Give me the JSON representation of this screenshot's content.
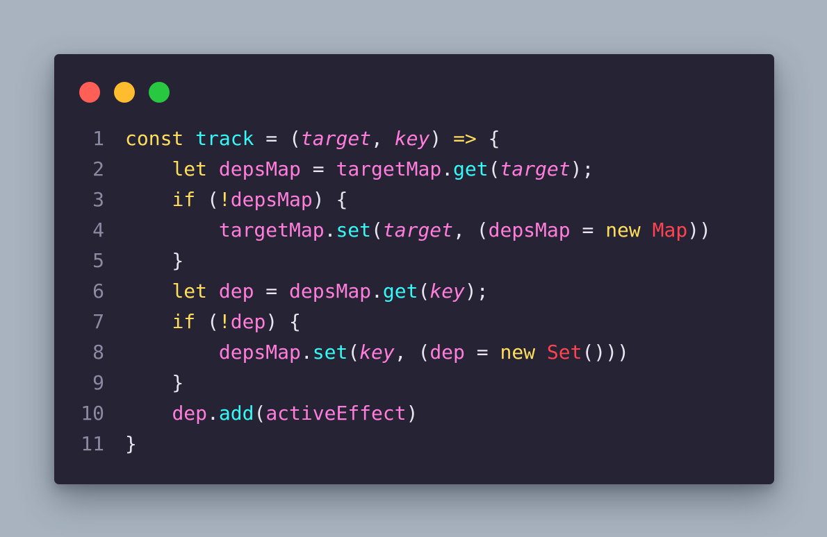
{
  "colors": {
    "background": "#a8b3bf",
    "window": "#262335",
    "close": "#ff5f57",
    "minimize": "#febc2e",
    "maximize": "#28c840",
    "line_number": "#8b8aa0",
    "plain": "#e9e6f2",
    "keyword": "#fede5d",
    "function": "#36f9f6",
    "variable": "#ff7edb",
    "class": "#fe4450"
  },
  "window_controls": [
    {
      "name": "close",
      "icon": "red-circle"
    },
    {
      "name": "minimize",
      "icon": "yellow-circle"
    },
    {
      "name": "maximize",
      "icon": "green-circle"
    }
  ],
  "code_lines": [
    {
      "number": "1",
      "tokens": [
        {
          "text": "const",
          "type": "keyword"
        },
        {
          "text": " ",
          "type": "plain"
        },
        {
          "text": "track",
          "type": "function"
        },
        {
          "text": " = (",
          "type": "plain"
        },
        {
          "text": "target",
          "type": "param"
        },
        {
          "text": ", ",
          "type": "plain"
        },
        {
          "text": "key",
          "type": "param"
        },
        {
          "text": ") ",
          "type": "plain"
        },
        {
          "text": "=>",
          "type": "keyword"
        },
        {
          "text": " {",
          "type": "plain"
        }
      ]
    },
    {
      "number": "2",
      "tokens": [
        {
          "text": "    ",
          "type": "plain"
        },
        {
          "text": "let",
          "type": "keyword"
        },
        {
          "text": " ",
          "type": "plain"
        },
        {
          "text": "depsMap",
          "type": "variable"
        },
        {
          "text": " = ",
          "type": "plain"
        },
        {
          "text": "targetMap",
          "type": "variable"
        },
        {
          "text": ".",
          "type": "plain"
        },
        {
          "text": "get",
          "type": "function"
        },
        {
          "text": "(",
          "type": "plain"
        },
        {
          "text": "target",
          "type": "param"
        },
        {
          "text": ");",
          "type": "plain"
        }
      ]
    },
    {
      "number": "3",
      "tokens": [
        {
          "text": "    ",
          "type": "plain"
        },
        {
          "text": "if",
          "type": "keyword"
        },
        {
          "text": " (",
          "type": "plain"
        },
        {
          "text": "!",
          "type": "keyword"
        },
        {
          "text": "depsMap",
          "type": "variable"
        },
        {
          "text": ") {",
          "type": "plain"
        }
      ]
    },
    {
      "number": "4",
      "tokens": [
        {
          "text": "        ",
          "type": "plain"
        },
        {
          "text": "targetMap",
          "type": "variable"
        },
        {
          "text": ".",
          "type": "plain"
        },
        {
          "text": "set",
          "type": "function"
        },
        {
          "text": "(",
          "type": "plain"
        },
        {
          "text": "target",
          "type": "param"
        },
        {
          "text": ", (",
          "type": "plain"
        },
        {
          "text": "depsMap",
          "type": "variable"
        },
        {
          "text": " = ",
          "type": "plain"
        },
        {
          "text": "new",
          "type": "keyword"
        },
        {
          "text": " ",
          "type": "plain"
        },
        {
          "text": "Map",
          "type": "class"
        },
        {
          "text": "))",
          "type": "plain"
        }
      ]
    },
    {
      "number": "5",
      "tokens": [
        {
          "text": "    }",
          "type": "plain"
        }
      ]
    },
    {
      "number": "6",
      "tokens": [
        {
          "text": "    ",
          "type": "plain"
        },
        {
          "text": "let",
          "type": "keyword"
        },
        {
          "text": " ",
          "type": "plain"
        },
        {
          "text": "dep",
          "type": "variable"
        },
        {
          "text": " = ",
          "type": "plain"
        },
        {
          "text": "depsMap",
          "type": "variable"
        },
        {
          "text": ".",
          "type": "plain"
        },
        {
          "text": "get",
          "type": "function"
        },
        {
          "text": "(",
          "type": "plain"
        },
        {
          "text": "key",
          "type": "param"
        },
        {
          "text": ");",
          "type": "plain"
        }
      ]
    },
    {
      "number": "7",
      "tokens": [
        {
          "text": "    ",
          "type": "plain"
        },
        {
          "text": "if",
          "type": "keyword"
        },
        {
          "text": " (",
          "type": "plain"
        },
        {
          "text": "!",
          "type": "keyword"
        },
        {
          "text": "dep",
          "type": "variable"
        },
        {
          "text": ") {",
          "type": "plain"
        }
      ]
    },
    {
      "number": "8",
      "tokens": [
        {
          "text": "        ",
          "type": "plain"
        },
        {
          "text": "depsMap",
          "type": "variable"
        },
        {
          "text": ".",
          "type": "plain"
        },
        {
          "text": "set",
          "type": "function"
        },
        {
          "text": "(",
          "type": "plain"
        },
        {
          "text": "key",
          "type": "param"
        },
        {
          "text": ", (",
          "type": "plain"
        },
        {
          "text": "dep",
          "type": "variable"
        },
        {
          "text": " = ",
          "type": "plain"
        },
        {
          "text": "new",
          "type": "keyword"
        },
        {
          "text": " ",
          "type": "plain"
        },
        {
          "text": "Set",
          "type": "class"
        },
        {
          "text": "()))",
          "type": "plain"
        }
      ]
    },
    {
      "number": "9",
      "tokens": [
        {
          "text": "    }",
          "type": "plain"
        }
      ]
    },
    {
      "number": "10",
      "tokens": [
        {
          "text": "    ",
          "type": "plain"
        },
        {
          "text": "dep",
          "type": "variable"
        },
        {
          "text": ".",
          "type": "plain"
        },
        {
          "text": "add",
          "type": "function"
        },
        {
          "text": "(",
          "type": "plain"
        },
        {
          "text": "activeEffect",
          "type": "variable"
        },
        {
          "text": ")",
          "type": "plain"
        }
      ]
    },
    {
      "number": "11",
      "tokens": [
        {
          "text": "}",
          "type": "plain"
        }
      ]
    }
  ]
}
